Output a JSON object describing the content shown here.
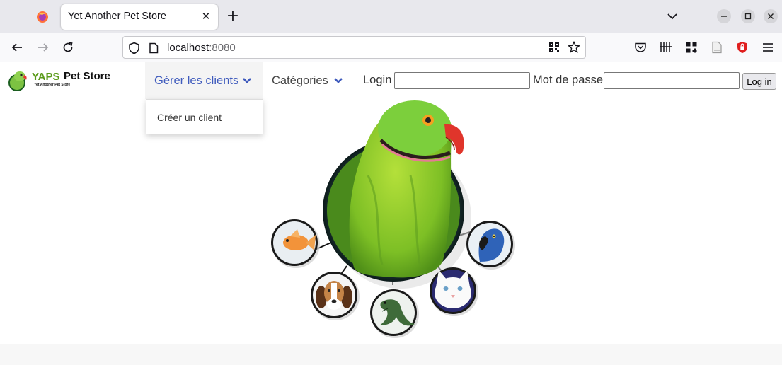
{
  "browser": {
    "tab_title": "Yet Another Pet Store",
    "url_host": "localhost",
    "url_port": ":8080"
  },
  "brand": {
    "name_yaps": "YAPS",
    "name_store": "Pet Store",
    "tagline": "Yet Another Pet Store"
  },
  "nav": {
    "customers_label": "Gérer les clients",
    "categories_label": "Catégories",
    "customers_menu": [
      {
        "label": "Créer un client"
      }
    ]
  },
  "login": {
    "login_label": "Login",
    "password_label": "Mot de passe",
    "login_value": "",
    "password_value": "",
    "submit_label": "Log in"
  },
  "colors": {
    "accent": "#3f5bbd",
    "brand_green": "#5a9a1a"
  },
  "hero": {
    "pets": [
      "parrot",
      "goldfish",
      "dog",
      "iguana",
      "cat",
      "macaw"
    ]
  }
}
